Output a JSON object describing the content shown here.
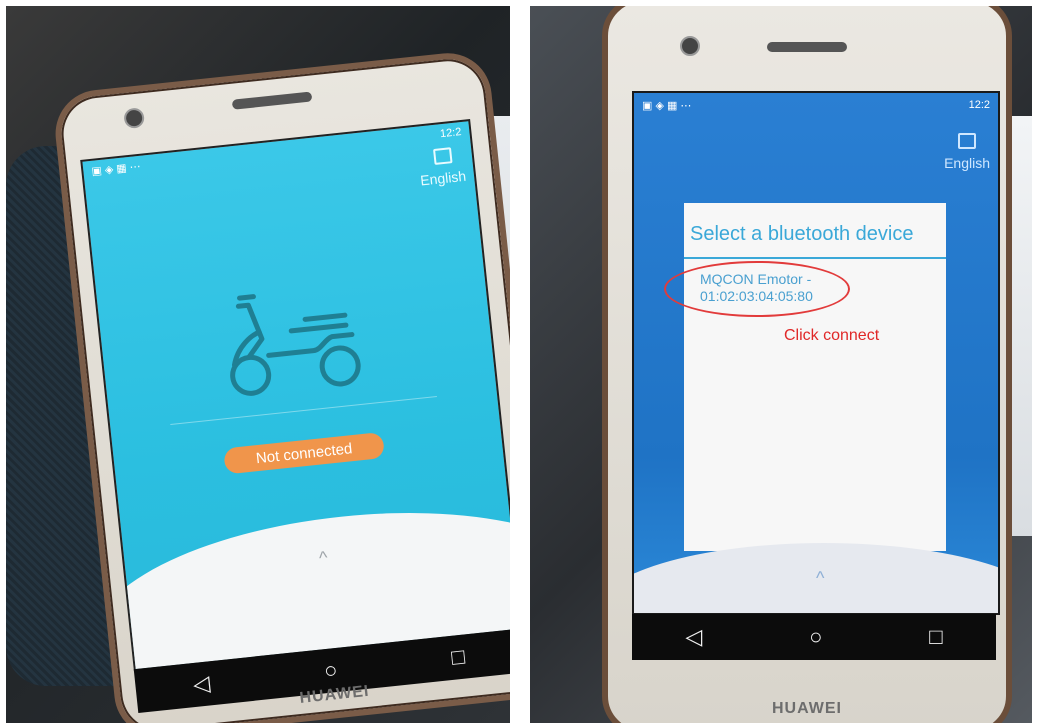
{
  "left_phone": {
    "status_time": "12:2",
    "language_label": "English",
    "connection_status": "Not connected",
    "brand": "HUAWEI",
    "nav": {
      "back": "◁",
      "home": "○",
      "recent": "□"
    },
    "scroll_hint": "^"
  },
  "right_phone": {
    "status_time": "12:2",
    "language_label": "English",
    "dialog_title": "Select a bluetooth device",
    "device_name": "MQCON Emotor -",
    "device_address": "01:02:03:04:05:80",
    "annotation": "Click connect",
    "brand": "HUAWEI",
    "nav": {
      "back": "◁",
      "home": "○",
      "recent": "□"
    },
    "scroll_hint": "^"
  }
}
